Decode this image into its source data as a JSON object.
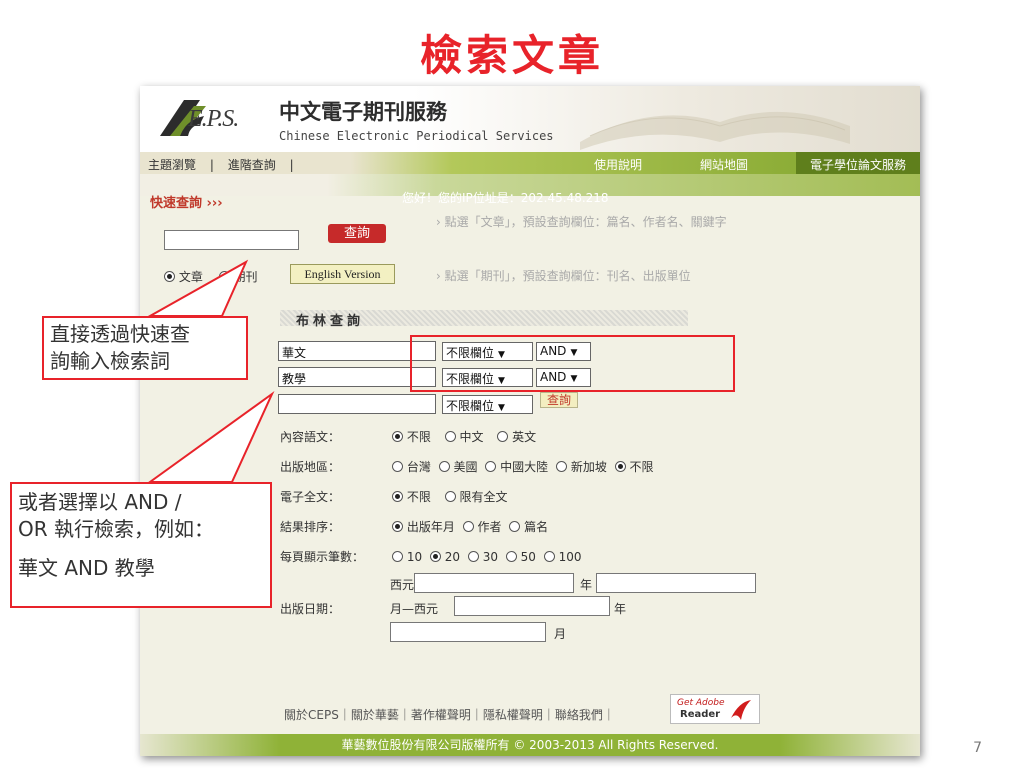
{
  "slide": {
    "title": "檢索文章",
    "number": "7"
  },
  "site": {
    "logo_text": "E.P.S.",
    "title": "中文電子期刊服務",
    "subtitle": "Chinese Electronic Periodical Services"
  },
  "nav": {
    "left_items": [
      "主題瀏覽",
      "|",
      "進階查詢",
      "|"
    ],
    "help": "使用說明",
    "sitemap": "網站地圖",
    "thesis": "電子學位論文服務"
  },
  "quick_search": {
    "label": "快速查詢 ›››",
    "ip_text": "您好！您的IP位址是：202.45.48.218",
    "input_value": "",
    "button": "查詢",
    "tip1": "› 點選「文章」，預設查詢欄位：篇名、作者名、關鍵字",
    "tip2": "› 點選「期刊」，預設查詢欄位：刊名、出版單位",
    "radio_article": "文章",
    "radio_journal": "期刊",
    "english_button": "English Version"
  },
  "boolean": {
    "title": "布林查詢",
    "rows": [
      {
        "value": "華文",
        "field": "不限欄位",
        "op": "AND"
      },
      {
        "value": "教學",
        "field": "不限欄位",
        "op": "AND"
      },
      {
        "value": "",
        "field": "不限欄位"
      }
    ],
    "button": "查詢"
  },
  "options": {
    "language_label": "內容語文：",
    "language": [
      "不限",
      "中文",
      "英文"
    ],
    "region_label": "出版地區：",
    "region": [
      "台灣",
      "美國",
      "中國大陸",
      "新加坡",
      "不限"
    ],
    "fulltext_label": "電子全文：",
    "fulltext": [
      "不限",
      "限有全文"
    ],
    "sort_label": "結果排序：",
    "sort": [
      "出版年月",
      "作者",
      "篇名"
    ],
    "perpage_label": "每頁顯示筆數：",
    "perpage": [
      "10",
      "20",
      "30",
      "50",
      "100"
    ],
    "date_label": "出版日期：",
    "date_western": "西元",
    "date_year": "年",
    "date_month_to": "月—西元",
    "date_month": "月"
  },
  "footer": {
    "links": "關於CEPS｜關於華藝｜著作權聲明｜隱私權聲明｜聯絡我們｜",
    "adobe_get": "Get Adobe",
    "adobe_reader": "Reader",
    "copyright": "華藝數位股份有限公司版權所有 © 2003-2013 All Rights Reserved."
  },
  "callouts": {
    "c1_line1": "直接透過快速查",
    "c1_line2": "詢輸入檢索詞",
    "c2_line1": "或者選擇以 AND /",
    "c2_line2": "OR 執行檢索，例如：",
    "c2_line3": "華文 AND 教學"
  },
  "colors": {
    "accent": "#e8232a",
    "nav_green": "#7ea32a",
    "panel": "#f2f1e4"
  }
}
